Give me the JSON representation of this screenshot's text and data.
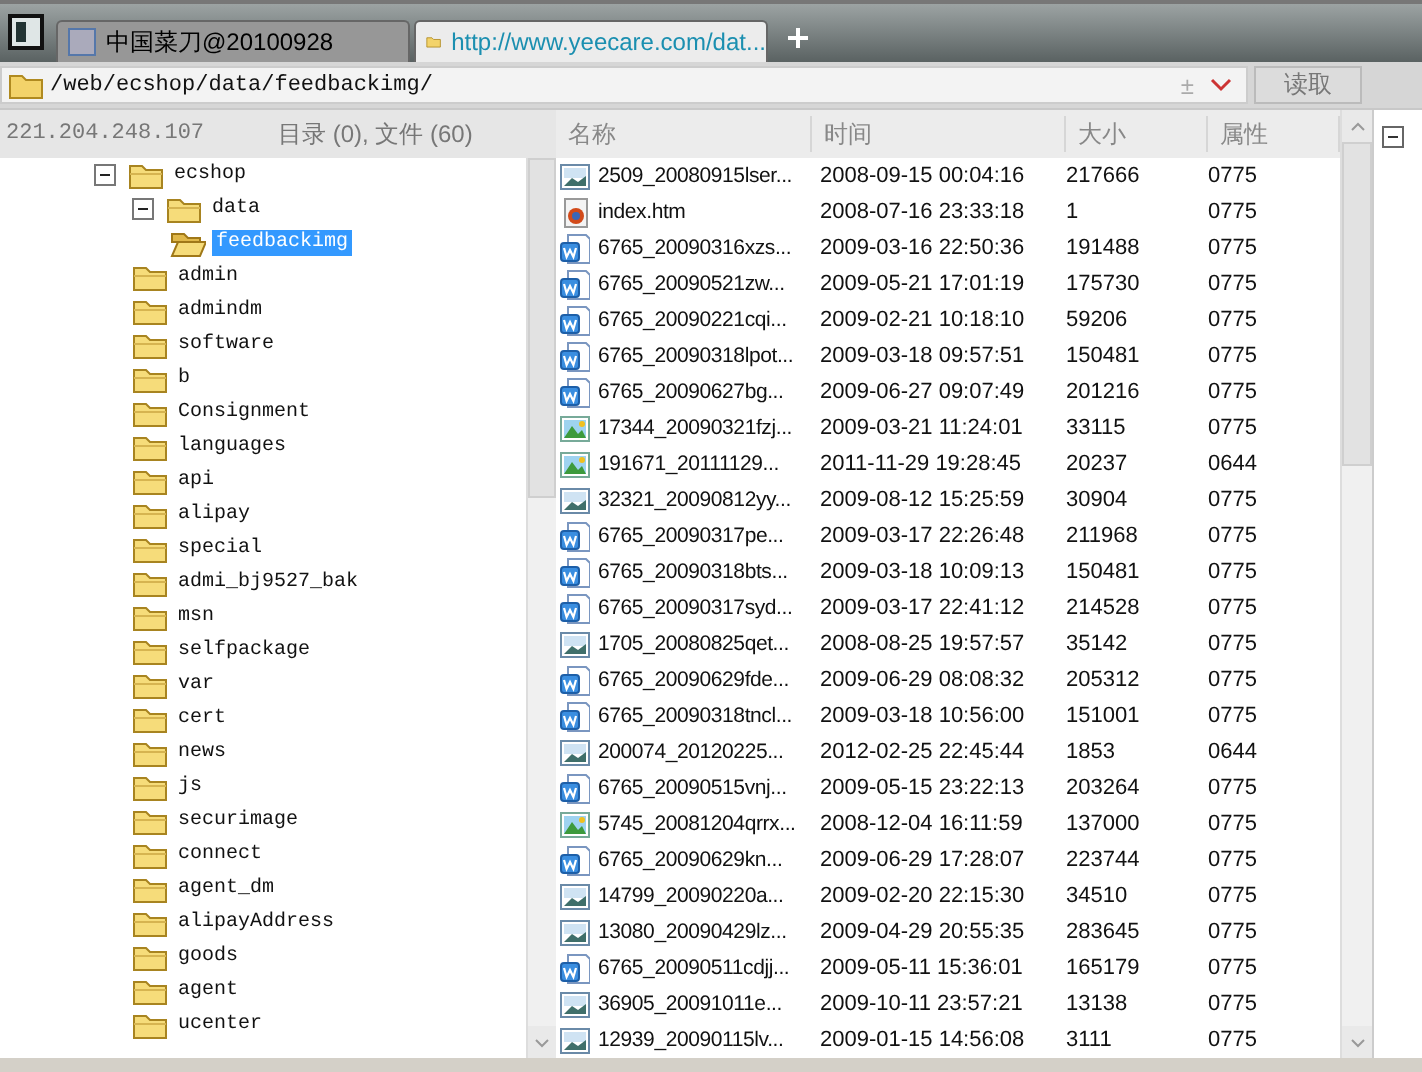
{
  "tabs": [
    {
      "label": "中国菜刀@20100928",
      "kind": "app",
      "selected": false
    },
    {
      "label": "http://www.yeecare.com/dat...",
      "kind": "folder",
      "selected": true
    }
  ],
  "address": {
    "path": "/web/ecshop/data/feedbackimg/",
    "extra": "±",
    "button": "读取"
  },
  "info": {
    "host": "221.204.248.107",
    "count": "目录 (0), 文件 (60)"
  },
  "columns": [
    "名称",
    "时间",
    "大小",
    "属性"
  ],
  "tree": [
    {
      "label": "ecshop",
      "expanded": true,
      "selected": false,
      "children": [
        {
          "label": "data",
          "expanded": true,
          "selected": false,
          "children": [
            {
              "label": "feedbackimg",
              "selected": true
            }
          ]
        },
        {
          "label": "admin",
          "selected": false
        },
        {
          "label": "admindm",
          "selected": false
        },
        {
          "label": "software",
          "selected": false
        },
        {
          "label": "b",
          "selected": false
        },
        {
          "label": "Consignment",
          "selected": false
        },
        {
          "label": "languages",
          "selected": false
        },
        {
          "label": "api",
          "selected": false
        },
        {
          "label": "alipay",
          "selected": false
        },
        {
          "label": "special",
          "selected": false
        },
        {
          "label": "admi_bj9527_bak",
          "selected": false
        },
        {
          "label": "msn",
          "selected": false
        },
        {
          "label": "selfpackage",
          "selected": false
        },
        {
          "label": "var",
          "selected": false
        },
        {
          "label": "cert",
          "selected": false
        },
        {
          "label": "news",
          "selected": false
        },
        {
          "label": "js",
          "selected": false
        },
        {
          "label": "securimage",
          "selected": false
        },
        {
          "label": "connect",
          "selected": false
        },
        {
          "label": "agent_dm",
          "selected": false
        },
        {
          "label": "alipayAddress",
          "selected": false
        },
        {
          "label": "goods",
          "selected": false
        },
        {
          "label": "agent",
          "selected": false
        },
        {
          "label": "ucenter",
          "selected": false
        }
      ]
    }
  ],
  "rows": [
    {
      "kind": "image",
      "name": "2509_20080915lser...",
      "time": "2008-09-15 00:04:16",
      "size": "217666",
      "mode": "0775"
    },
    {
      "kind": "web",
      "name": "index.htm",
      "time": "2008-07-16 23:33:18",
      "size": "1",
      "mode": "0775"
    },
    {
      "kind": "doc",
      "name": "6765_20090316xzs...",
      "time": "2009-03-16 22:50:36",
      "size": "191488",
      "mode": "0775"
    },
    {
      "kind": "doc",
      "name": "6765_20090521zw...",
      "time": "2009-05-21 17:01:19",
      "size": "175730",
      "mode": "0775"
    },
    {
      "kind": "doc",
      "name": "6765_20090221cqi...",
      "time": "2009-02-21 10:18:10",
      "size": "59206",
      "mode": "0775"
    },
    {
      "kind": "doc",
      "name": "6765_20090318lpot...",
      "time": "2009-03-18 09:57:51",
      "size": "150481",
      "mode": "0775"
    },
    {
      "kind": "doc",
      "name": "6765_20090627bg...",
      "time": "2009-06-27 09:07:49",
      "size": "201216",
      "mode": "0775"
    },
    {
      "kind": "photo",
      "name": "17344_20090321fzj...",
      "time": "2009-03-21 11:24:01",
      "size": "33115",
      "mode": "0775"
    },
    {
      "kind": "photo",
      "name": "191671_20111129...",
      "time": "2011-11-29 19:28:45",
      "size": "20237",
      "mode": "0644"
    },
    {
      "kind": "image",
      "name": "32321_20090812yy...",
      "time": "2009-08-12 15:25:59",
      "size": "30904",
      "mode": "0775"
    },
    {
      "kind": "doc",
      "name": "6765_20090317pe...",
      "time": "2009-03-17 22:26:48",
      "size": "211968",
      "mode": "0775"
    },
    {
      "kind": "doc",
      "name": "6765_20090318bts...",
      "time": "2009-03-18 10:09:13",
      "size": "150481",
      "mode": "0775"
    },
    {
      "kind": "doc",
      "name": "6765_20090317syd...",
      "time": "2009-03-17 22:41:12",
      "size": "214528",
      "mode": "0775"
    },
    {
      "kind": "image",
      "name": "1705_20080825qet...",
      "time": "2008-08-25 19:57:57",
      "size": "35142",
      "mode": "0775"
    },
    {
      "kind": "doc",
      "name": "6765_20090629fde...",
      "time": "2009-06-29 08:08:32",
      "size": "205312",
      "mode": "0775"
    },
    {
      "kind": "doc",
      "name": "6765_20090318tncl...",
      "time": "2009-03-18 10:56:00",
      "size": "151001",
      "mode": "0775"
    },
    {
      "kind": "image",
      "name": "200074_20120225...",
      "time": "2012-02-25 22:45:44",
      "size": "1853",
      "mode": "0644"
    },
    {
      "kind": "doc",
      "name": "6765_20090515vnj...",
      "time": "2009-05-15 23:22:13",
      "size": "203264",
      "mode": "0775"
    },
    {
      "kind": "photo",
      "name": "5745_20081204qrrx...",
      "time": "2008-12-04 16:11:59",
      "size": "137000",
      "mode": "0775"
    },
    {
      "kind": "doc",
      "name": "6765_20090629kn...",
      "time": "2009-06-29 17:28:07",
      "size": "223744",
      "mode": "0775"
    },
    {
      "kind": "image",
      "name": "14799_20090220a...",
      "time": "2009-02-20 22:15:30",
      "size": "34510",
      "mode": "0775"
    },
    {
      "kind": "image",
      "name": "13080_20090429lz...",
      "time": "2009-04-29 20:55:35",
      "size": "283645",
      "mode": "0775"
    },
    {
      "kind": "doc",
      "name": "6765_20090511cdjj...",
      "time": "2009-05-11 15:36:01",
      "size": "165179",
      "mode": "0775"
    },
    {
      "kind": "image",
      "name": "36905_20091011e...",
      "time": "2009-10-11 23:57:21",
      "size": "13138",
      "mode": "0775"
    },
    {
      "kind": "image",
      "name": "12939_20090115lv...",
      "time": "2009-01-15 14:56:08",
      "size": "3111",
      "mode": "0775"
    }
  ]
}
